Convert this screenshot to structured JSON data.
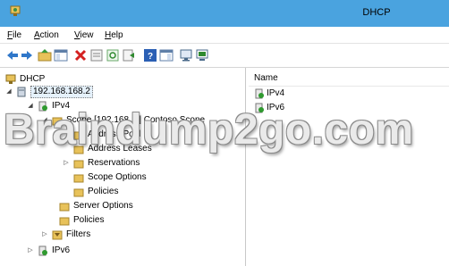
{
  "window": {
    "title": "DHCP",
    "titlebar_color": "#4aa3df",
    "app_icon": "dhcp-app-icon"
  },
  "menu": {
    "items": [
      "File",
      "Action",
      "View",
      "Help"
    ],
    "mnemonics": [
      "F",
      "A",
      "V",
      "H"
    ]
  },
  "toolbar": {
    "icons": [
      "back-icon",
      "forward-icon",
      "up-folder-icon",
      "show-hide-tree-icon",
      "delete-icon",
      "properties-icon",
      "refresh-icon",
      "export-list-icon",
      "help-icon",
      "show-hide-action-pane-icon",
      "display-statistics-icon",
      "computer-icon"
    ]
  },
  "tree": {
    "root": "DHCP",
    "server": "192.168.168.2",
    "ipv4": "IPv4",
    "scope": "Scope [192.168.1.] Contoso Scope",
    "address_pool": "Address Pool",
    "address_leases": "Address Leases",
    "reservations": "Reservations",
    "scope_options": "Scope Options",
    "scope_policies": "Policies",
    "server_options": "Server Options",
    "policies": "Policies",
    "filters": "Filters",
    "ipv6": "IPv6"
  },
  "list": {
    "column_name": "Name",
    "items": [
      "IPv4",
      "IPv6"
    ]
  },
  "watermark": {
    "text": "Braindump2go.com"
  }
}
